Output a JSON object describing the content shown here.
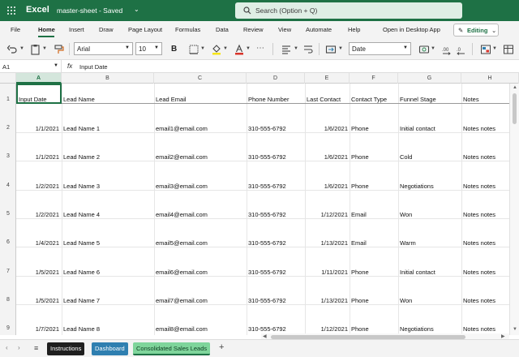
{
  "titlebar": {
    "app_name": "Excel",
    "doc_title": "master-sheet  -  Saved",
    "search_placeholder": "Search (Option + Q)"
  },
  "menu": {
    "tabs": [
      "File",
      "Home",
      "Insert",
      "Draw",
      "Page Layout",
      "Formulas",
      "Data",
      "Review",
      "View",
      "Automate",
      "Help"
    ],
    "active_tab": "Home",
    "open_desktop": "Open in Desktop App",
    "editing": "Editing"
  },
  "ribbon": {
    "font_name": "Arial",
    "font_size": "10",
    "bold": "B",
    "number_format": "Date",
    "font_color": "#d9342b",
    "fill_color": "#f6e516"
  },
  "formula_bar": {
    "name_box": "A1",
    "fx": "fx",
    "content": "Input Date"
  },
  "grid": {
    "columns": [
      "A",
      "B",
      "C",
      "D",
      "E",
      "F",
      "G",
      "H"
    ],
    "selected_column": "A",
    "header_row": {
      "row_number": "1",
      "A": "Input Date",
      "B": "Lead Name",
      "C": "Lead Email",
      "D": "Phone Number",
      "E": "Last Contact",
      "F": "Contact Type",
      "G": "Funnel Stage",
      "H": "Notes"
    },
    "rows": [
      {
        "row_number": "2",
        "A": "1/1/2021",
        "B": "Lead Name 1",
        "C": "email1@email.com",
        "D": "310-555-6792",
        "E": "1/6/2021",
        "F": "Phone",
        "G": "Initial contact",
        "H": "Notes notes"
      },
      {
        "row_number": "3",
        "A": "1/1/2021",
        "B": "Lead Name 2",
        "C": "email2@email.com",
        "D": "310-555-6792",
        "E": "1/6/2021",
        "F": "Phone",
        "G": "Cold",
        "H": "Notes notes"
      },
      {
        "row_number": "4",
        "A": "1/2/2021",
        "B": "Lead Name 3",
        "C": "email3@email.com",
        "D": "310-555-6792",
        "E": "1/6/2021",
        "F": "Phone",
        "G": "Negotiations",
        "H": "Notes notes"
      },
      {
        "row_number": "5",
        "A": "1/2/2021",
        "B": "Lead Name 4",
        "C": "email4@email.com",
        "D": "310-555-6792",
        "E": "1/12/2021",
        "F": "Email",
        "G": "Won",
        "H": "Notes notes"
      },
      {
        "row_number": "6",
        "A": "1/4/2021",
        "B": "Lead Name 5",
        "C": "email5@email.com",
        "D": "310-555-6792",
        "E": "1/13/2021",
        "F": "Email",
        "G": "Warm",
        "H": "Notes notes"
      },
      {
        "row_number": "7",
        "A": "1/5/2021",
        "B": "Lead Name 6",
        "C": "email6@email.com",
        "D": "310-555-6792",
        "E": "1/11/2021",
        "F": "Phone",
        "G": "Initial contact",
        "H": "Notes notes"
      },
      {
        "row_number": "8",
        "A": "1/5/2021",
        "B": "Lead Name 7",
        "C": "email7@email.com",
        "D": "310-555-6792",
        "E": "1/13/2021",
        "F": "Phone",
        "G": "Won",
        "H": "Notes notes"
      },
      {
        "row_number": "9",
        "A": "1/7/2021",
        "B": "Lead Name 8",
        "C": "email8@email.com",
        "D": "310-555-6792",
        "E": "1/12/2021",
        "F": "Phone",
        "G": "Negotiations",
        "H": "Notes notes"
      }
    ]
  },
  "sheets": {
    "tabs": [
      "Instructions",
      "Dashboard",
      "Consolidated Sales Leads"
    ],
    "active": "Consolidated Sales Leads"
  }
}
